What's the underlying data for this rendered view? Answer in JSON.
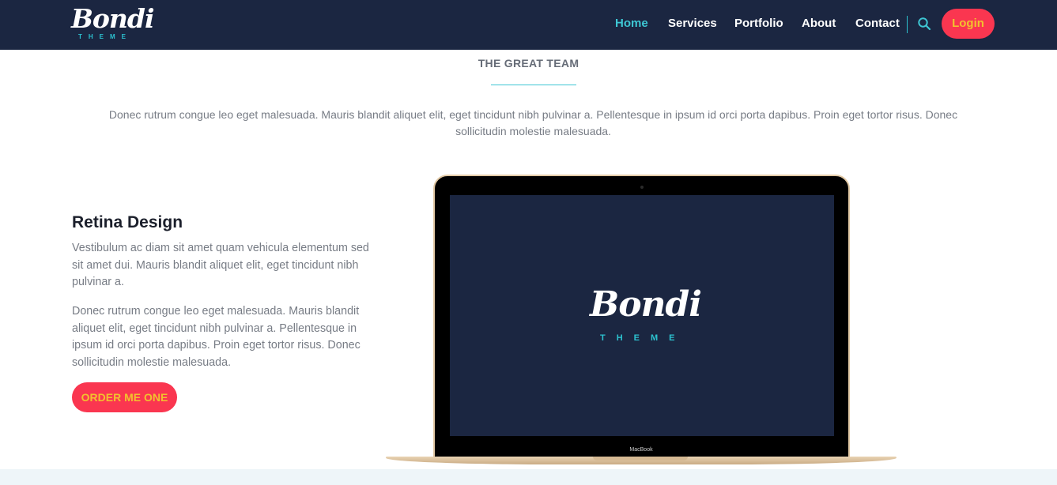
{
  "brand": {
    "name": "Bondi",
    "tagline": "THEME"
  },
  "nav": {
    "items": [
      "Home",
      "Services",
      "Portfolio",
      "About",
      "Contact"
    ],
    "active": "Home",
    "login_label": "Login"
  },
  "section": {
    "title": "THE GREAT TEAM",
    "intro": "Donec rutrum congue leo eget malesuada. Mauris blandit aliquet elit, eget tincidunt nibh pulvinar a. Pellentesque in ipsum id orci porta dapibus. Proin eget tortor risus. Donec sollicitudin molestie malesuada."
  },
  "feature": {
    "title": "Retina Design",
    "paragraph1": "Vestibulum ac diam sit amet quam vehicula elementum sed sit amet dui. Mauris blandit aliquet elit, eget tincidunt nibh pulvinar a.",
    "paragraph2": "Donec rutrum congue leo eget malesuada. Mauris blandit aliquet elit, eget tincidunt nibh pulvinar a. Pellentesque in ipsum id orci porta dapibus. Proin eget tortor risus. Donec sollicitudin molestie malesuada.",
    "button_label": "ORDER ME ONE"
  },
  "laptop": {
    "screen_brand": "Bondi",
    "screen_tagline": "THEME",
    "model_label": "MacBook"
  },
  "colors": {
    "navy": "#1b2641",
    "accent": "#3ec6d3",
    "button": "#fa3650",
    "button_text": "#f2c12e"
  },
  "icons": {
    "search": "search-icon"
  }
}
